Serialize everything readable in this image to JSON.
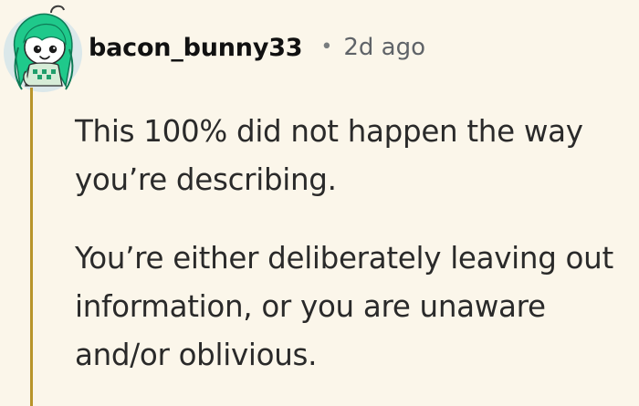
{
  "comment": {
    "username": "bacon_bunny33",
    "separator": "•",
    "timestamp": "2d ago",
    "paragraphs": [
      "This 100% did not happen the way you’re describing.",
      "You’re either deliberately leaving out information, or you are unaware and/or oblivious."
    ],
    "avatar_icon": "snoo-avatar-icon",
    "colors": {
      "background": "#fbf6ea",
      "thread_line": "#b8942a",
      "avatar_hair": "#1fc98b",
      "avatar_background": "#dbe8ea"
    }
  }
}
